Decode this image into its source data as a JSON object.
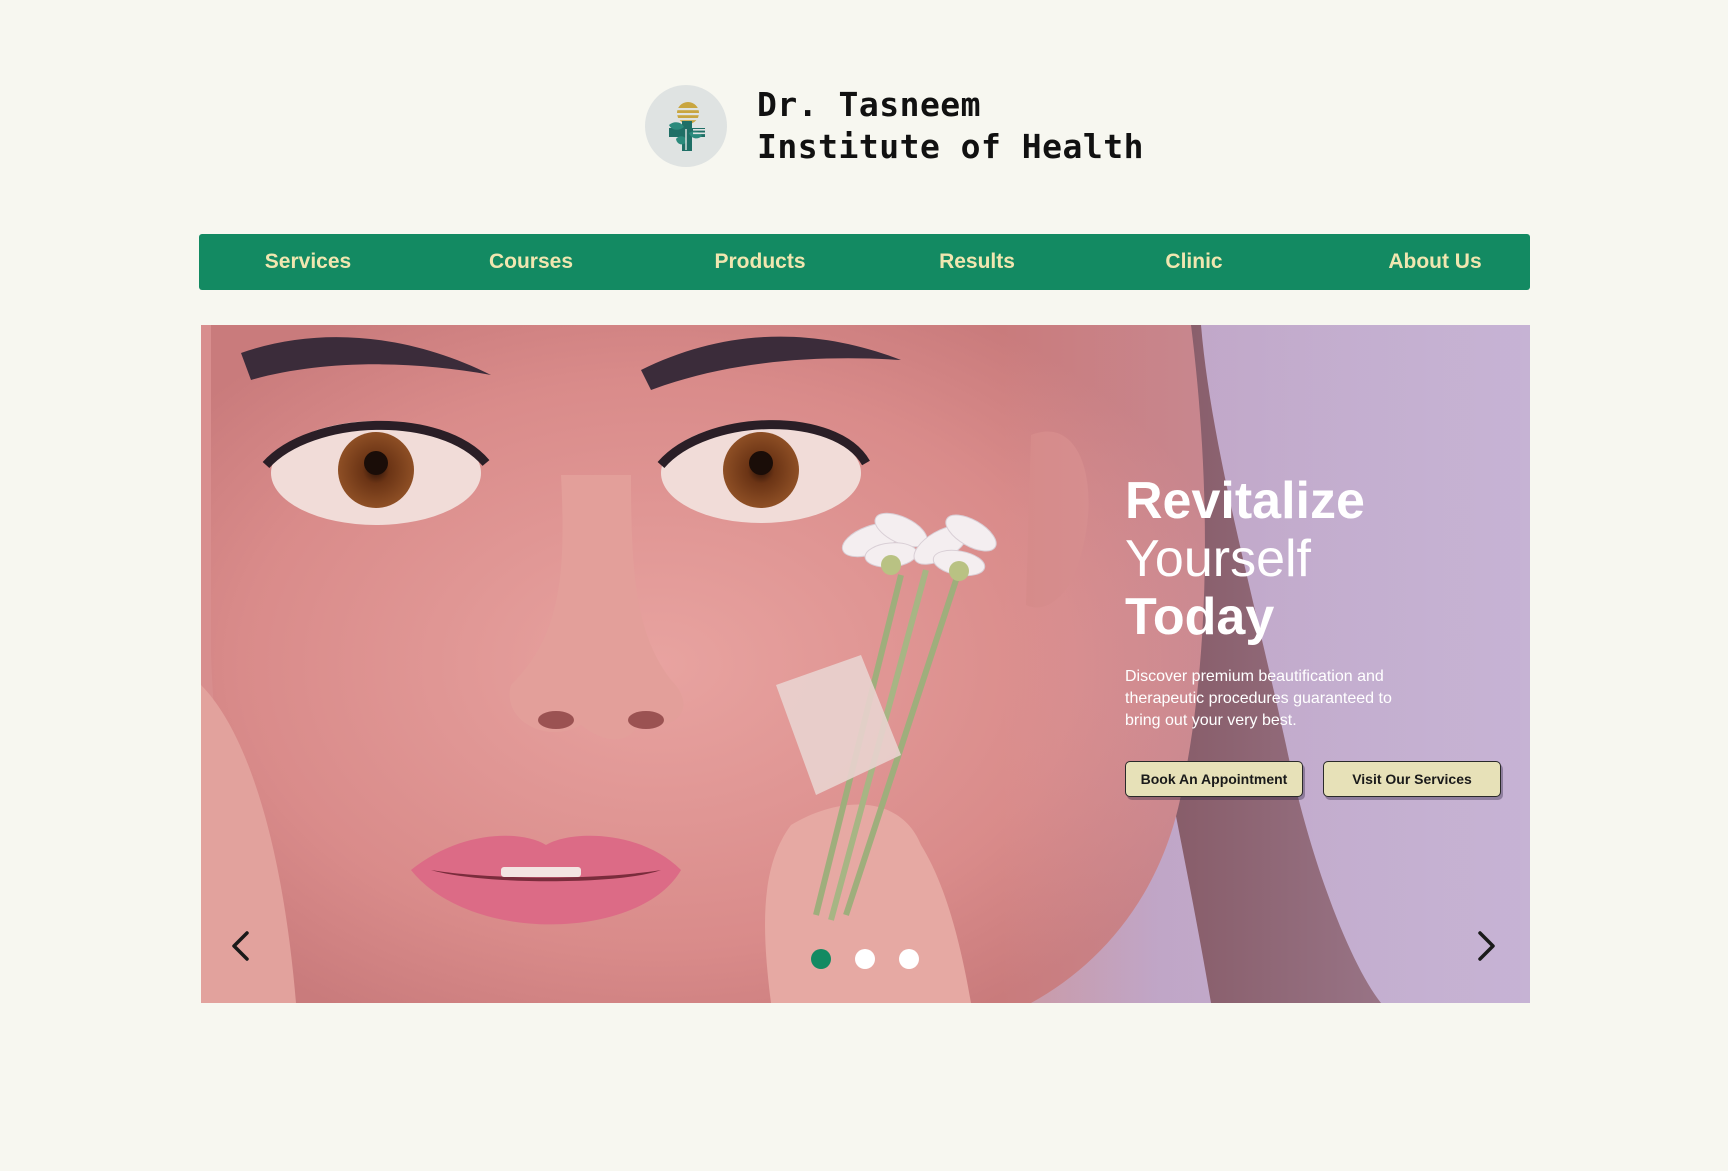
{
  "brand": {
    "name_line1": "Dr. Tasneem",
    "name_line2": "Institute of Health",
    "logo_icon": "leaf-cross-logo-icon"
  },
  "nav": {
    "items": [
      {
        "label": "Services"
      },
      {
        "label": "Courses"
      },
      {
        "label": "Products"
      },
      {
        "label": "Results"
      },
      {
        "label": "Clinic"
      },
      {
        "label": "About Us"
      }
    ]
  },
  "hero": {
    "headline_line1": "Revitalize",
    "headline_line2": "Yourself",
    "headline_line3": "Today",
    "description": "Discover premium beautification and therapeutic procedures guaranteed to bring out your very best.",
    "primary_button": "Book An Appointment",
    "secondary_button": "Visit Our Services",
    "image_subject": "woman's face holding white daisies to her cheek",
    "prev_icon": "chevron-left-icon",
    "next_icon": "chevron-right-icon",
    "slide_count": 3,
    "active_slide": 1
  },
  "colors": {
    "page_background": "#f7f7f0",
    "nav_background": "#138a62",
    "nav_text": "#f0e6b0",
    "button_background": "#e7e1b8",
    "active_dot": "#138a62",
    "hero_background": "#c9b2cf"
  }
}
